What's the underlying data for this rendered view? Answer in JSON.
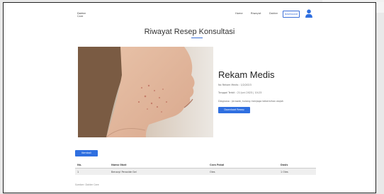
{
  "nav": {
    "logo_line1": "Dokter",
    "logo_line2": "Care",
    "home": "Home",
    "riwayat": "Riwayat",
    "dokter": "Dokter",
    "dashboard": "Dashboard"
  },
  "page": {
    "title": "Riwayat Resep Konsultasi"
  },
  "record": {
    "title": "Rekam Medis",
    "info_line1": "No Rekam Medis : 1/2/2023",
    "info_line2": "Tanggal Terbit : 21 Juni 2023 | 10:23",
    "info_line3": "Diagnosa : Jerawat, kulang menjaga kebersihan wajah",
    "download_label": "Download Resep"
  },
  "back_label": "Kembali",
  "table": {
    "headers": [
      "No.",
      "Nama Obat",
      "Cara Pakai",
      "Dosis"
    ],
    "rows": [
      [
        "1",
        "Benzoyl Peroxide Gel",
        "Oles",
        "1 Oles"
      ]
    ]
  },
  "footer_note": "Sumber: Dokter Care",
  "colors": {
    "accent": "#2f6fe0"
  }
}
